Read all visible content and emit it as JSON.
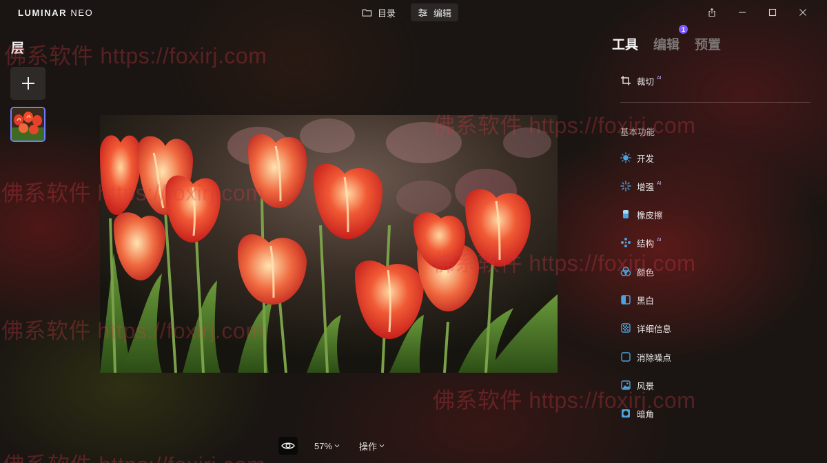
{
  "app": {
    "logo_main": "LUMINAR",
    "logo_sub": "NEO"
  },
  "topnav": {
    "catalog": "目录",
    "edit": "编辑"
  },
  "layers": {
    "title": "层"
  },
  "bottom": {
    "zoom": "57%",
    "actions": "操作"
  },
  "rtabs": {
    "tools": "工具",
    "edits": "编辑",
    "presets": "预置",
    "edits_badge": "1"
  },
  "tools": {
    "crop": "裁切",
    "ai_tag": "AI",
    "section_basic": "基本功能",
    "develop": "开发",
    "enhance": "增强",
    "erase": "橡皮擦",
    "structure": "结构",
    "color": "颜色",
    "bw": "黑白",
    "details": "详细信息",
    "denoise": "消除噪点",
    "landscape": "风景",
    "vignette": "暗角"
  },
  "watermark": {
    "text": "佛系软件 https://foxirj.com"
  },
  "colors": {
    "accent": "#6f7cff",
    "badge": "#7c5cff",
    "tool_icon": "#4aa3df"
  }
}
